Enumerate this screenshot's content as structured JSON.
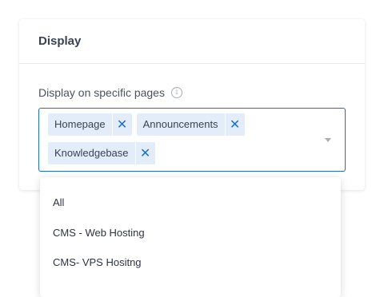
{
  "card": {
    "title": "Display"
  },
  "field": {
    "label": "Display on specific pages",
    "info_icon": "info-icon"
  },
  "selected_tags": [
    {
      "label": "Homepage",
      "remove_icon": "close-icon"
    },
    {
      "label": "Announcements",
      "remove_icon": "close-icon"
    },
    {
      "label": "Knowledgebase",
      "remove_icon": "close-icon"
    }
  ],
  "dropdown": {
    "caret_icon": "chevron-down-icon",
    "options": [
      "All",
      "CMS - Web Hosting",
      "CMS- VPS Hositng"
    ]
  },
  "colors": {
    "accent": "#1f6fc5",
    "tag_background": "#e3edfa",
    "text": "#3a4351"
  }
}
